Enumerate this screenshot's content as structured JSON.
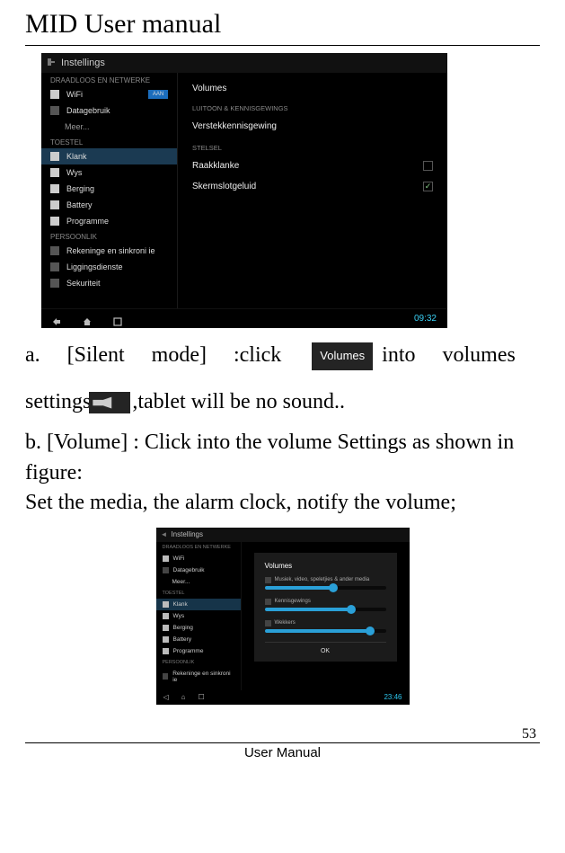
{
  "title": "MID User manual",
  "page_number": "53",
  "footer": "User Manual",
  "paragraph_a": {
    "pre": "a.",
    "w1": "[Silent",
    "w2": "mode]",
    "w3": ":click",
    "w4": "into",
    "w5": "volumes",
    "line2a": "settings",
    "line2b": ",tablet will be no sound.."
  },
  "volumes_badge": "Volumes",
  "paragraph_b": "b. [Volume] : Click into the volume Settings as shown in figure:",
  "paragraph_b2": "Set the media, the alarm clock, notify the volume;",
  "screenshot1": {
    "header": "Instellings",
    "section1": "DRAADLOOS EN NETWERKE",
    "wifi": "WiFi",
    "switch": "AAN",
    "data": "Datagebruik",
    "more": "Meer...",
    "section2": "TOESTEL",
    "klank": "Klank",
    "wys": "Wys",
    "berging": "Berging",
    "battery": "Battery",
    "programme": "Programme",
    "section3": "PERSOONLIK",
    "rek": "Rekeninge en sinkroni   ie",
    "ligging": "Liggingsdienste",
    "sekuriteit": "Sekuriteit",
    "r_section0": "",
    "r_volumes": "Volumes",
    "r_section1": "LUITOON & KENNISGEWINGS",
    "r_verstek": "Verstekkennisgewing",
    "r_verstek_sub": "",
    "r_section2": "STELSEL",
    "r_raakklanke": "Raakklanke",
    "r_skerm": "Skermslotgeluid",
    "time": "09:32"
  },
  "screenshot2": {
    "header": "Instellings",
    "dialog_title": "Volumes",
    "label1": "Musiek, video, speletjies & ander media",
    "label2": "Kennisgewings",
    "label3": "Wekkers",
    "ok": "OK",
    "time": "23:46"
  }
}
